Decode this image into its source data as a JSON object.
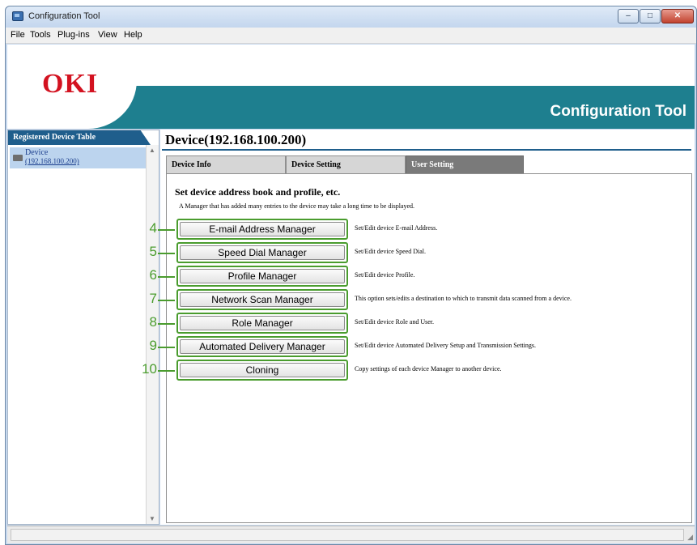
{
  "window": {
    "title": "Configuration Tool",
    "controls": {
      "minimize": "–",
      "maximize": "□",
      "close": "✕"
    }
  },
  "menu": [
    "File",
    "Tools",
    "Plug-ins",
    "View",
    "Help"
  ],
  "banner": {
    "logo": "OKI",
    "title": "Configuration Tool"
  },
  "left_panel": {
    "header": "Registered Device Table",
    "device": {
      "name": "Device",
      "ip": "(192.168.100.200)"
    }
  },
  "main": {
    "device_title": "Device(192.168.100.200)",
    "tabs": [
      {
        "label": "Device Info",
        "selected": false
      },
      {
        "label": "Device Setting",
        "selected": false
      },
      {
        "label": "User Setting",
        "selected": true
      }
    ],
    "heading": "Set device address book and profile, etc.",
    "note": "A Manager that has added many entries to the device may take a long time to be displayed.",
    "rows": [
      {
        "callout": "4",
        "button": "E-mail Address Manager",
        "description": "Set/Edit device E-mail Address."
      },
      {
        "callout": "5",
        "button": "Speed Dial Manager",
        "description": "Set/Edit device Speed Dial."
      },
      {
        "callout": "6",
        "button": "Profile Manager",
        "description": "Set/Edit device Profile."
      },
      {
        "callout": "7",
        "button": "Network Scan Manager",
        "description": "This option sets/edits a destination to which to transmit data scanned from a device."
      },
      {
        "callout": "8",
        "button": "Role Manager",
        "description": "Set/Edit device Role  and User."
      },
      {
        "callout": "9",
        "button": "Automated Delivery Manager",
        "description": "Set/Edit device Automated Delivery Setup and Transmission Settings."
      },
      {
        "callout": "10",
        "button": "Cloning",
        "description": "Copy settings of each device Manager to another device."
      }
    ]
  },
  "colors": {
    "accent_teal": "#1e7f8f",
    "header_blue": "#1f5e8c",
    "logo_red": "#d31220",
    "callout_green": "#4a9c2e"
  },
  "icons": [
    "app-icon",
    "device-icon",
    "scroll-up-icon",
    "scroll-down-icon",
    "resize-grip-icon"
  ]
}
